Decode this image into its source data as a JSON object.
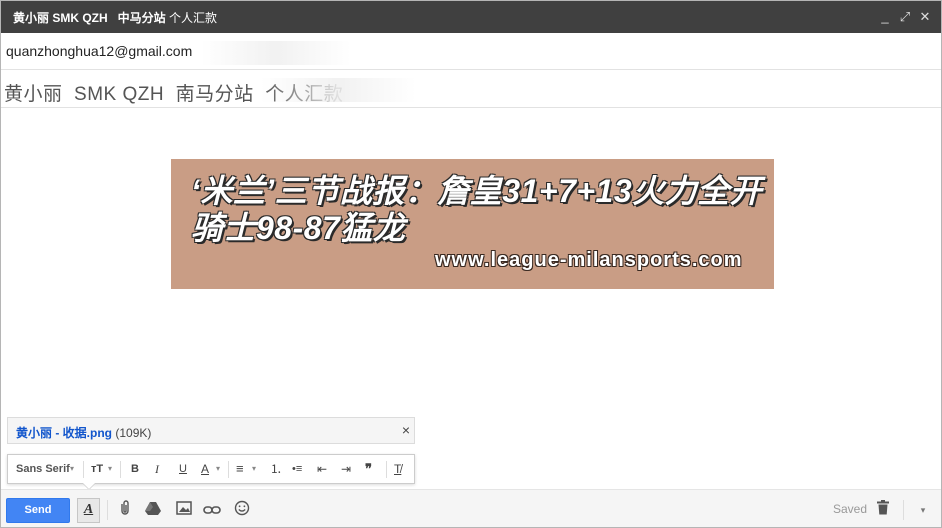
{
  "window": {
    "title_bold": "黄小丽 SMK QZH   中马分站",
    "title_rest": " 个人汇款",
    "minimize": "_",
    "popout": "⤢",
    "close": "✕"
  },
  "compose": {
    "to": "quanzhonghua12@gmail.com",
    "subject": "黄小丽  SMK QZH  南马分站  个人汇款"
  },
  "banner": {
    "headline": "‘米兰’三节战报：詹皇31+7+13火力全开 骑士98-87猛龙",
    "site": "www.league-milansports.com",
    "bg_color": "#c99d85"
  },
  "attachment": {
    "name": "黄小丽 - 收据.png",
    "size": "(109K)",
    "remove": "×"
  },
  "format_toolbar": {
    "font": "Sans Serif",
    "font_dropdown": "▾",
    "size": "ᴛT",
    "size_dropdown": "▾",
    "bold": "B",
    "italic": "I",
    "underline": "U",
    "text_color": "A",
    "color_dropdown": "▾",
    "align": "≡",
    "align_dropdown": "▾",
    "numbered_list": "⒈",
    "bulleted_list": "•≡",
    "indent_less": "⇤",
    "indent_more": "⇥",
    "quote": "❞",
    "clear_format": "T̸"
  },
  "bottom_bar": {
    "send": "Send",
    "format_toggle": "A",
    "attach_icon": "paperclip-icon",
    "drive_icon": "drive-icon",
    "photo_icon": "photo-icon",
    "link_icon": "link-icon",
    "emoji_icon": "emoji-icon",
    "status": "Saved",
    "more": "▾"
  }
}
